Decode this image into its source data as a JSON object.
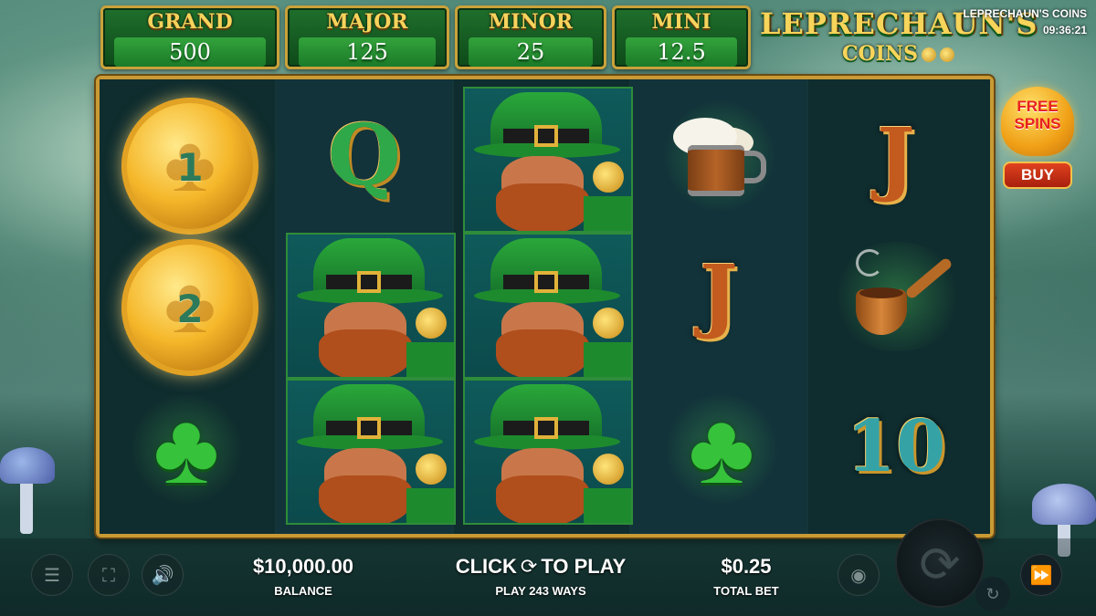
{
  "game": {
    "title": "LEPRECHAUN'S COINS",
    "clock": "09:36:21",
    "logo_line1": "LEPRECHAUN'S",
    "logo_line2": "COINS"
  },
  "jackpots": [
    {
      "label": "GRAND",
      "value": "500"
    },
    {
      "label": "MAJOR",
      "value": "125"
    },
    {
      "label": "MINOR",
      "value": "25"
    },
    {
      "label": "MINI",
      "value": "12.5"
    }
  ],
  "ways_indicator": [
    "2",
    "4",
    "3"
  ],
  "reels": {
    "reel1": [
      {
        "symbol": "coin",
        "value": "1"
      },
      {
        "symbol": "coin",
        "value": "2"
      },
      {
        "symbol": "clover"
      }
    ],
    "reel2": [
      {
        "symbol": "Q"
      },
      {
        "symbol": "leprechaun"
      },
      {
        "symbol": "leprechaun"
      }
    ],
    "reel3": [
      {
        "symbol": "leprechaun"
      },
      {
        "symbol": "leprechaun"
      },
      {
        "symbol": "leprechaun"
      }
    ],
    "reel4": [
      {
        "symbol": "ale-mug"
      },
      {
        "symbol": "J"
      },
      {
        "symbol": "clover"
      }
    ],
    "reel5": [
      {
        "symbol": "J"
      },
      {
        "symbol": "pipe"
      },
      {
        "symbol": "10"
      }
    ]
  },
  "free_spins": {
    "label_line1": "FREE",
    "label_line2": "SPINS",
    "buy_label": "BUY"
  },
  "bottom": {
    "balance_value": "$10,000.00",
    "balance_label": "BALANCE",
    "play_prefix": "CLICK",
    "play_suffix": "TO PLAY",
    "play_ways": "PLAY 243 WAYS",
    "bet_value": "$0.25",
    "bet_label": "TOTAL BET"
  },
  "icons": {
    "menu": "menu-icon",
    "fullscreen": "fullscreen-icon",
    "sound": "sound-icon",
    "coins": "coins-icon",
    "spin": "spin-icon",
    "autoplay": "autoplay-icon",
    "turbo": "fast-forward-icon"
  },
  "colors": {
    "gold": "#f6d35c",
    "jackpot_green": "#1f6f2c",
    "frame_gold": "#c99a34",
    "buy_red": "#c8301a"
  }
}
